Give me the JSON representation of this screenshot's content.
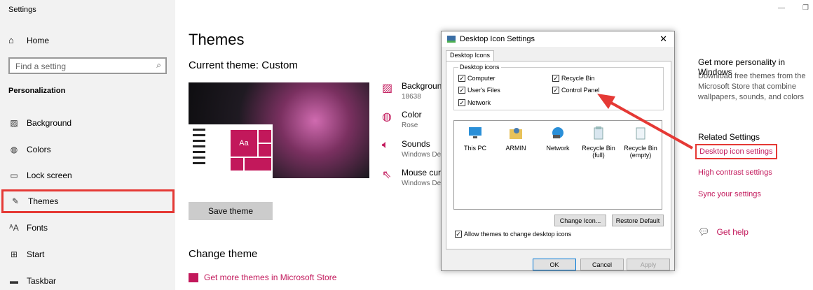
{
  "window": {
    "title": "Settings"
  },
  "sidebar": {
    "home_label": "Home",
    "search_placeholder": "Find a setting",
    "section_title": "Personalization",
    "items": [
      {
        "label": "Background",
        "icon": "image-icon"
      },
      {
        "label": "Colors",
        "icon": "palette-icon"
      },
      {
        "label": "Lock screen",
        "icon": "lock-screen-icon"
      },
      {
        "label": "Themes",
        "icon": "themes-icon",
        "active": true
      },
      {
        "label": "Fonts",
        "icon": "fonts-icon"
      },
      {
        "label": "Start",
        "icon": "start-icon"
      },
      {
        "label": "Taskbar",
        "icon": "taskbar-icon"
      }
    ]
  },
  "main": {
    "title": "Themes",
    "current_theme": "Current theme: Custom",
    "preview_tile_text": "Aa",
    "settings": [
      {
        "title": "Background",
        "sub": "18638"
      },
      {
        "title": "Color",
        "sub": "Rose"
      },
      {
        "title": "Sounds",
        "sub": "Windows Def"
      },
      {
        "title": "Mouse curso",
        "sub": "Windows Def"
      }
    ],
    "save_button": "Save theme",
    "change_theme": "Change theme",
    "store_link": "Get more themes in Microsoft Store"
  },
  "right": {
    "heading": "Get more personality in Windows",
    "description": "Download free themes from the Microsoft Store that combine wallpapers, sounds, and colors",
    "related_title": "Related Settings",
    "links": [
      "Desktop icon settings",
      "High contrast settings",
      "Sync your settings"
    ],
    "help": "Get help"
  },
  "dialog": {
    "title": "Desktop Icon Settings",
    "close": "✕",
    "tab": "Desktop Icons",
    "group_label": "Desktop icons",
    "checkboxes": [
      {
        "label": "Computer",
        "checked": true
      },
      {
        "label": "Recycle Bin",
        "checked": true
      },
      {
        "label": "User's Files",
        "checked": true
      },
      {
        "label": "Control Panel",
        "checked": true
      },
      {
        "label": "Network",
        "checked": true
      }
    ],
    "icons": [
      {
        "label": "This PC"
      },
      {
        "label": "ARMIN"
      },
      {
        "label": "Network"
      },
      {
        "label": "Recycle Bin\n(full)"
      },
      {
        "label": "Recycle Bin\n(empty)"
      }
    ],
    "change_icon": "Change Icon...",
    "restore_default": "Restore Default",
    "allow_themes": "Allow themes to change desktop icons",
    "ok": "OK",
    "cancel": "Cancel",
    "apply": "Apply"
  },
  "colors": {
    "accent": "#c2185b",
    "highlight": "#e53935"
  }
}
